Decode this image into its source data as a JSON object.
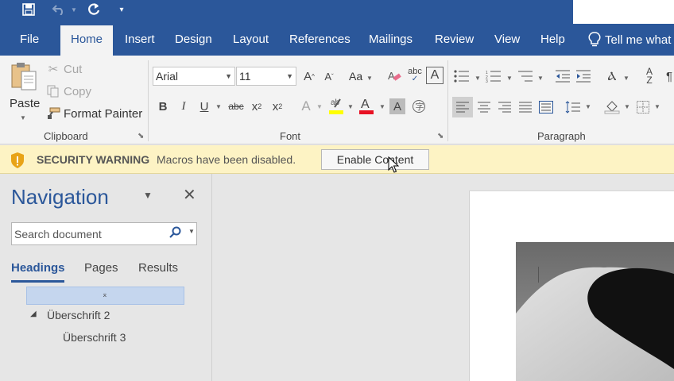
{
  "qat": {
    "save_icon": "save-icon",
    "undo_icon": "undo-icon",
    "redo_icon": "redo-icon",
    "customize_icon": "customize-qat-icon"
  },
  "tabs": [
    {
      "label": "File"
    },
    {
      "label": "Home"
    },
    {
      "label": "Insert"
    },
    {
      "label": "Design"
    },
    {
      "label": "Layout"
    },
    {
      "label": "References"
    },
    {
      "label": "Mailings"
    },
    {
      "label": "Review"
    },
    {
      "label": "View"
    },
    {
      "label": "Help"
    }
  ],
  "tell_me": "Tell me what",
  "clipboard": {
    "paste": "Paste",
    "cut": "Cut",
    "copy": "Copy",
    "format_painter": "Format Painter",
    "group_label": "Clipboard"
  },
  "font": {
    "name": "Arial",
    "size": "11",
    "change_case": "Aa",
    "group_label": "Font"
  },
  "paragraph": {
    "group_label": "Paragraph"
  },
  "security": {
    "title": "SECURITY WARNING",
    "message": "Macros have been disabled.",
    "button": "Enable Content"
  },
  "navigation": {
    "title": "Navigation",
    "search_placeholder": "Search document",
    "tabs": [
      "Headings",
      "Pages",
      "Results"
    ],
    "headings": [
      "Überschrift 2",
      "Überschrift 3"
    ]
  },
  "colors": {
    "accent": "#2b579a",
    "security_bar": "#fdf3c4",
    "highlight_yellow": "#ffff00",
    "font_red": "#e81123"
  }
}
